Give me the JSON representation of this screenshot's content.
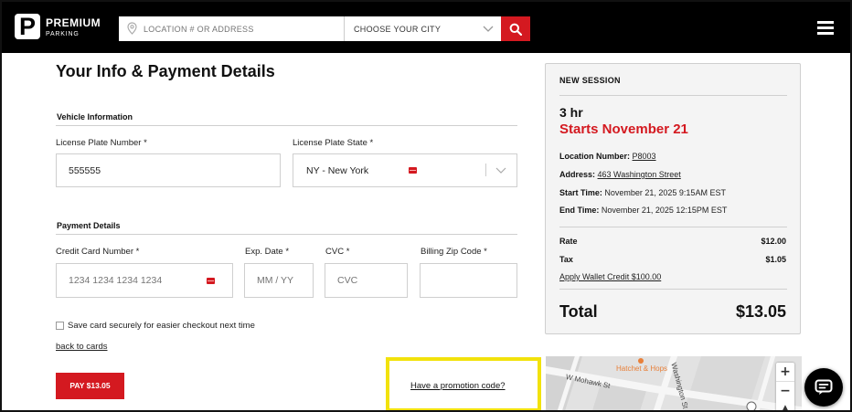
{
  "header": {
    "brand_line1": "PREMIUM",
    "brand_line2": "PARKING",
    "search_placeholder": "LOCATION # OR ADDRESS",
    "city_select": "CHOOSE YOUR CITY"
  },
  "form": {
    "title": "Your Info & Payment Details",
    "vehicle_section": "Vehicle Information",
    "plate_label": "License Plate Number *",
    "plate_value": "555555",
    "state_label": "License Plate State *",
    "state_value": "NY - New York",
    "payment_section": "Payment Details",
    "card_label": "Credit Card Number *",
    "card_placeholder": "1234 1234 1234 1234",
    "exp_label": "Exp. Date *",
    "exp_placeholder": "MM / YY",
    "cvc_label": "CVC *",
    "cvc_placeholder": "CVC",
    "zip_label": "Billing Zip Code *",
    "zip_placeholder": "",
    "save_card_label": "Save card securely for easier checkout next time",
    "back_link": "back to cards",
    "pay_button": "PAY $13.05",
    "promo_link": "Have a promotion code?"
  },
  "summary": {
    "heading": "NEW SESSION",
    "duration": "3 hr",
    "starts": "Starts November 21",
    "location_label": "Location Number:",
    "location_value": "P8003",
    "address_label": "Address:",
    "address_value": "463 Washington Street",
    "start_label": "Start Time:",
    "start_value": "November 21, 2025 9:15AM EST",
    "end_label": "End Time:",
    "end_value": "November 21, 2025 12:15PM EST",
    "rate_label": "Rate",
    "rate_value": "$12.00",
    "tax_label": "Tax",
    "tax_value": "$1.05",
    "wallet_link": "Apply Wallet Credit $100.00",
    "total_label": "Total",
    "total_value": "$13.05"
  },
  "map": {
    "poi": "Hatchet & Hops",
    "street1": "W Mohawk St",
    "street2": "Washington St",
    "zoom_in": "+",
    "zoom_out": "−"
  },
  "colors": {
    "brand_red": "#d41920",
    "header_bg": "#000000",
    "highlight": "#f2e20c"
  },
  "icons": [
    "map-pin-icon",
    "chevron-down-icon",
    "search-icon",
    "menu-icon",
    "card-icon",
    "chat-icon"
  ]
}
